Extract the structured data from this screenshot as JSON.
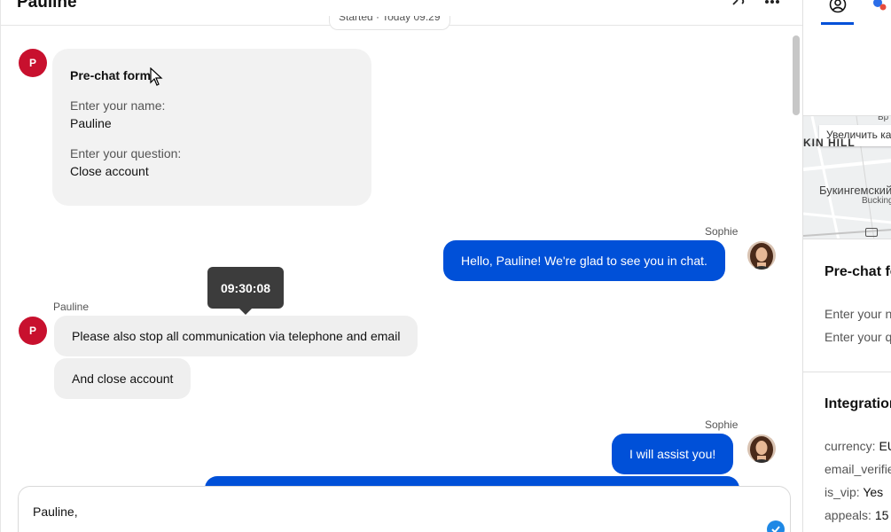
{
  "chat": {
    "title": "Pauline",
    "started_label": "Started · Today 09:29"
  },
  "prechat": {
    "title": "Pre-chat form",
    "name_label": "Enter your name:",
    "name_value": "Pauline",
    "question_label": "Enter your question:",
    "question_value": "Close account"
  },
  "messages": {
    "sophie_name": "Sophie",
    "pauline_name": "Pauline",
    "avatar_initial": "P",
    "m1": "Hello, Pauline! We're glad to see you in chat.",
    "m2": "Please also stop all communication via telephone and email",
    "m3": "And close account",
    "m4": "I will assist you!",
    "tooltip_time": "09:30:08"
  },
  "composer": {
    "value": "Pauline,"
  },
  "side": {
    "map": {
      "zoom_label": "Увеличить карту",
      "area_label": "KIN HILL",
      "place_label": "Букингемский",
      "place_sub": "Buckingham",
      "corner_label": "Бр"
    },
    "prechat_title": "Pre-chat form",
    "prechat_line1": "Enter your name",
    "prechat_line2": "Enter your question",
    "integration_title": "Integration",
    "kv": [
      {
        "key": "currency:",
        "value": "EUR"
      },
      {
        "key": "email_verified:",
        "value": "true"
      },
      {
        "key": "is_vip:",
        "value": "Yes"
      },
      {
        "key": "appeals:",
        "value": "15"
      }
    ]
  },
  "colors": {
    "accent": "#0050d8",
    "avatar_red": "#c8102e",
    "bubble_in": "#efefef"
  }
}
